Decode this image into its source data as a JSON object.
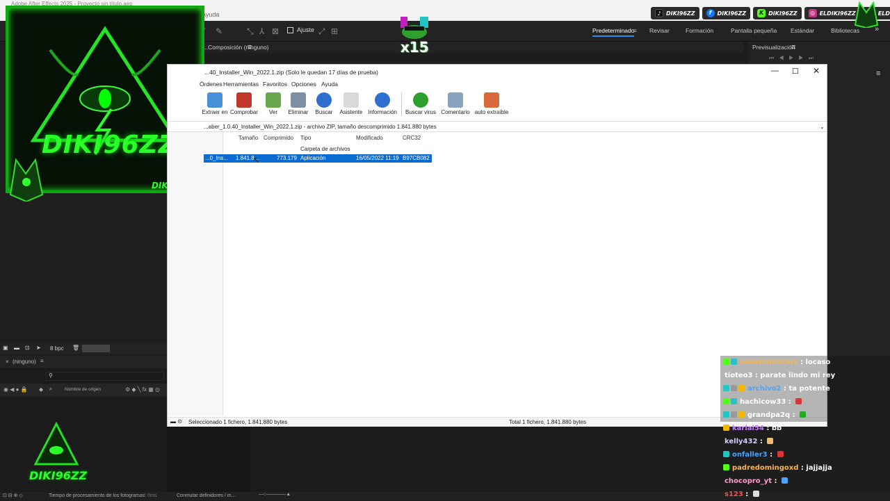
{
  "ae": {
    "title": "Adobe After Effects 2025 - Proyecto sin título.aep",
    "menu_help": "Ayuda",
    "ajuste_label": "Ajuste",
    "workspace_tabs": [
      "Predeterminado",
      "Revisar",
      "Formación",
      "Pantalla pequeña",
      "Estándar",
      "Bibliotecas"
    ],
    "composition_head": "Composición (ninguno)",
    "preview_head": "Previsualización",
    "bpc_label": "8 bpc",
    "timeline_tab": "(ninguno)",
    "timeline_source_col": "Nombre de origen",
    "timeline_hash_col": "#",
    "status_render_time": "Tiempo de procesamiento de los fotogramas:",
    "status_render_value": "0ms",
    "status_toggle": "Conmutar definidores / m..."
  },
  "overlay": {
    "logo_text": "DIKI96ZZ",
    "logo_subtext": "DIKI96ZZ",
    "small_logo_text": "DIKI96ZZ",
    "multiplier": "x15",
    "socials": [
      {
        "icon": "tiktok-icon",
        "label": "DIKI96ZZ",
        "color": "#111111"
      },
      {
        "icon": "facebook-icon",
        "label": "DIKI96ZZ",
        "color": "#1877f2"
      },
      {
        "icon": "kick-icon",
        "label": "DIKI96ZZ",
        "color": "#53fc18"
      },
      {
        "icon": "instagram-icon",
        "label": "ELDIKI96ZZ",
        "color": "#c13584"
      },
      {
        "icon": "youtube-icon",
        "label": "ELDIKI",
        "color": "#ff0000"
      }
    ]
  },
  "winrar": {
    "title": "...40_Installer_Win_2022.1.zip (Solo le quedan 17 días de prueba)",
    "menu": [
      "Órdenes",
      "Herramientas",
      "Favoritos",
      "Opciones",
      "Ayuda"
    ],
    "toolbar": [
      {
        "label": "Extraer en",
        "color": "#4a90d9"
      },
      {
        "label": "Comprobar",
        "color": "#c0392b"
      },
      {
        "label": "Ver",
        "color": "#6aa84f"
      },
      {
        "label": "Eliminar",
        "color": "#7d8fa3"
      },
      {
        "label": "Buscar",
        "color": "#2f6fcf"
      },
      {
        "label": "Asistente",
        "color": "#d9d9d9"
      },
      {
        "label": "Información",
        "color": "#2f6fcf"
      },
      {
        "label": "Buscar virus",
        "color": "#2ea02e"
      },
      {
        "label": "Comentario",
        "color": "#8aa3bf"
      },
      {
        "label": "auto extraíble",
        "color": "#d9693a"
      }
    ],
    "path": "...aber_1.0.40_Installer_Win_2022.1.zip - archivo ZIP, tamaño descomprimido 1.841.880 bytes",
    "columns": [
      "Tamaño",
      "Comprimido",
      "Tipo",
      "Modificado",
      "CRC32"
    ],
    "folder_row": {
      "type": "Carpeta de archivos"
    },
    "file_row": {
      "name": "...0_Ins...",
      "size": "1.841.8...",
      "compressed": "773.179",
      "type": "Aplicación",
      "modified": "16/05/2022 11:19",
      "crc": "B97CB082"
    },
    "status_left": "Seleccionado 1 fichero, 1.841.880 bytes",
    "status_right": "Total 1 fichero, 1.841.880 bytes"
  },
  "chat": [
    {
      "name": "valentintintin1",
      "name_color": "#ffb347",
      "msg": "locaso",
      "boxed": true,
      "badges": [
        "#53fc18",
        "#23c4c4"
      ]
    },
    {
      "name": "tioteo3",
      "name_color": "#ffffff",
      "msg": "parate lindo mi rey",
      "boxed": true,
      "badges": []
    },
    {
      "name": "archivo2",
      "name_color": "#4aa3ff",
      "msg": "ta potente",
      "boxed": true,
      "badges": [
        "#23c4c4",
        "#999999",
        "#f2b600"
      ]
    },
    {
      "name": "hachicow33",
      "name_color": "#ffffff",
      "msg": "",
      "boxed": true,
      "badges": [
        "#53fc18",
        "#23c4c4"
      ],
      "emote": "#d33"
    },
    {
      "name": "grandpa2q",
      "name_color": "#ffffff",
      "msg": "",
      "boxed": true,
      "badges": [
        "#23c4c4",
        "#999999",
        "#f2b600"
      ],
      "emote": "#2a2"
    },
    {
      "name": "karlai54",
      "name_color": "#c57cff",
      "msg": "bb",
      "boxed": false,
      "badges": [
        "#f2b600"
      ]
    },
    {
      "name": "kelly432",
      "name_color": "#cfcfff",
      "msg": "",
      "boxed": false,
      "badges": [],
      "emote": "#f0c070"
    },
    {
      "name": "onfaller3",
      "name_color": "#4aa3ff",
      "msg": "",
      "boxed": false,
      "badges": [
        "#23c4c4"
      ],
      "emote": "#d33"
    },
    {
      "name": "padredomingoxd",
      "name_color": "#ffb347",
      "msg": "jajjajja",
      "boxed": false,
      "badges": [
        "#53fc18"
      ]
    },
    {
      "name": "chocopro_yt",
      "name_color": "#ff9fd0",
      "msg": "",
      "boxed": false,
      "badges": [],
      "emote": "#4aa3ff"
    },
    {
      "name": "s123",
      "name_color": "#ff4d4d",
      "msg": "",
      "boxed": false,
      "badges": [],
      "emote": "#ddd"
    }
  ]
}
